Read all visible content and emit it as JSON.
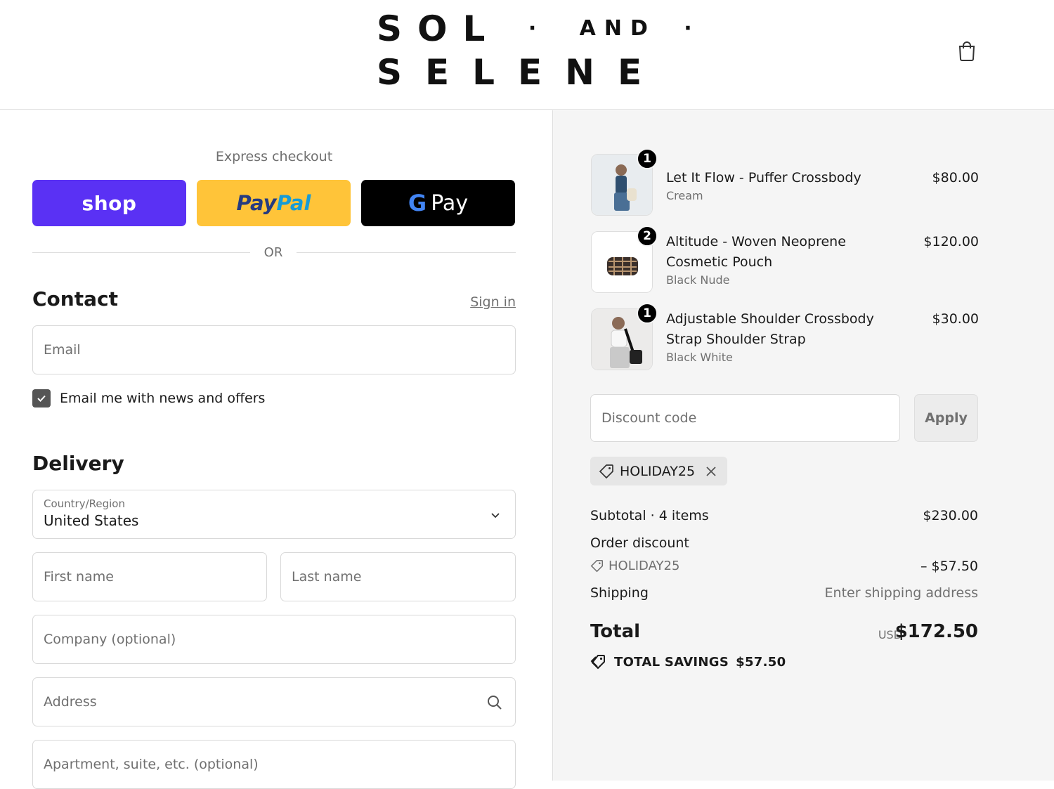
{
  "brand": {
    "logo_line1": "SOL",
    "logo_and": "AND",
    "logo_line2": "SELENE"
  },
  "express": {
    "label": "Express checkout",
    "shop_label": "shop",
    "paypal_label_1": "Pay",
    "paypal_label_2": "Pal",
    "gpay_g": "G",
    "gpay_label": "Pay",
    "or_label": "OR"
  },
  "contact": {
    "title": "Contact",
    "sign_in": "Sign in",
    "email_placeholder": "Email",
    "newsletter_label": "Email me with news and offers",
    "newsletter_checked": true
  },
  "delivery": {
    "title": "Delivery",
    "country_label": "Country/Region",
    "country_value": "United States",
    "first_name_placeholder": "First name",
    "last_name_placeholder": "Last name",
    "company_placeholder": "Company (optional)",
    "address_placeholder": "Address",
    "apartment_placeholder": "Apartment, suite, etc. (optional)"
  },
  "cart": {
    "items": [
      {
        "name": "Let It Flow - Puffer Crossbody",
        "variant": "Cream",
        "price": "$80.00",
        "qty": "1"
      },
      {
        "name": "Altitude - Woven Neoprene Cosmetic Pouch",
        "variant": "Black Nude",
        "price": "$120.00",
        "qty": "2"
      },
      {
        "name": "Adjustable Shoulder Crossbody Strap Shoulder Strap",
        "variant": "Black White",
        "price": "$30.00",
        "qty": "1"
      }
    ]
  },
  "discount": {
    "placeholder": "Discount code",
    "apply_label": "Apply",
    "applied_code": "HOLIDAY25"
  },
  "summary": {
    "subtotal_label": "Subtotal · 4 items",
    "subtotal_value": "$230.00",
    "order_discount_label": "Order discount",
    "discount_code": "HOLIDAY25",
    "discount_value": "– $57.50",
    "shipping_label": "Shipping",
    "shipping_value": "Enter shipping address",
    "total_label": "Total",
    "currency": "USD",
    "total_value": "$172.50",
    "savings_label": "TOTAL SAVINGS",
    "savings_value": "$57.50"
  },
  "colors": {
    "shop_purple": "#5a31f4",
    "paypal_yellow": "#ffc439",
    "gpay_black": "#000000",
    "panel_gray": "#f5f5f5"
  },
  "icons": {
    "cart": "shopping-bag-icon",
    "search": "search-icon",
    "chevron": "chevron-down-icon",
    "tag": "tag-icon",
    "close": "close-icon",
    "savings": "double-tag-icon",
    "checkbox": "checkmark-icon"
  }
}
